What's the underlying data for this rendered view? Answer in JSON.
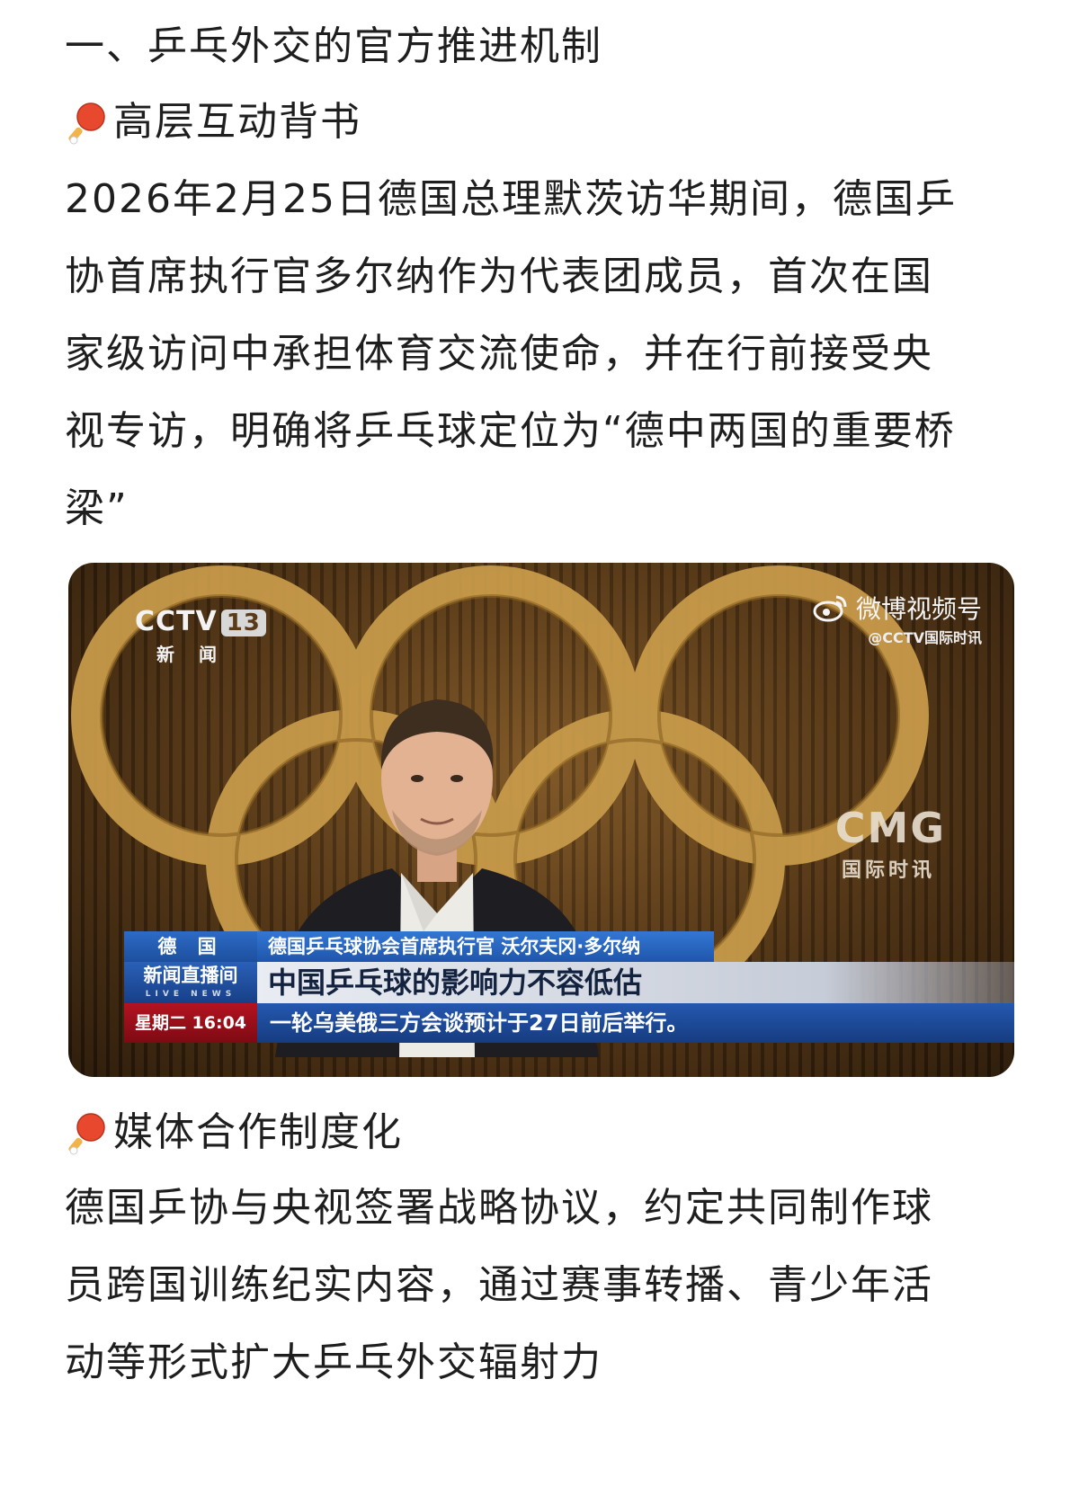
{
  "section_title": "一、乒乓外交的官方推进机制",
  "subsection1": {
    "icon": "ping-pong-paddle-icon",
    "title": "高层互动背书",
    "lines": [
      "2026年2月25日德国总理默茨访华期间，德国乒",
      "协首席执行官多尔纳作为代表团成员，首次在国",
      "家级访问中承担体育交流使命，并在行前接受央",
      "视专访，明确将乒乓球定位为“德中两国的重要桥",
      "梁”"
    ]
  },
  "video": {
    "channel_logo": "CCTV",
    "channel_number": "13",
    "channel_sub": "新 闻",
    "watermark_title": "微博视频号",
    "watermark_handle": "@CCTV国际时讯",
    "cmg_logo": "CMG",
    "cmg_sub": "国际时讯",
    "country_tag": "德 国",
    "speaker_title": "德国乒乓球协会首席执行官 沃尔夫冈·多尔纳",
    "live_label": "新闻直播间",
    "live_sub": "LIVE NEWS",
    "headline": "中国乒乓球的影响力不容低估",
    "clock": "星期二 16:04",
    "ticker": "一轮乌美俄三方会谈预计于27日前后举行。",
    "colors": {
      "rings": "#c79a4a",
      "live_red": "#b31320",
      "news_blue": "#1f56ab"
    }
  },
  "subsection2": {
    "icon": "ping-pong-paddle-icon",
    "title": "媒体合作制度化",
    "lines": [
      "德国乒协与央视签署战略协议，约定共同制作球",
      "员跨国训练纪实内容，通过赛事转播、青少年活",
      "动等形式扩大乒乓外交辐射力"
    ]
  }
}
